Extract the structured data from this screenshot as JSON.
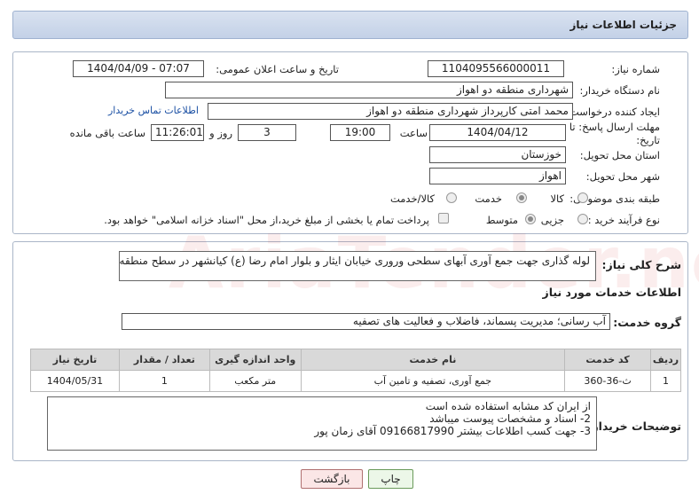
{
  "header": {
    "title": "جزئیات اطلاعات نیاز"
  },
  "watermark": "AriaTender.neT",
  "form": {
    "need_number_label": "شماره نیاز:",
    "need_number": "1104095566000011",
    "announce_label": "تاریخ و ساعت اعلان عمومی:",
    "announce_value": "1404/04/09 - 07:07",
    "buyer_org_label": "نام دستگاه خریدار:",
    "buyer_org": "شهرداری منطقه دو اهواز",
    "creator_label": "ایجاد کننده درخواست:",
    "creator": "محمد امتی کارپرداز شهرداری منطقه دو اهواز",
    "contact_link": "اطلاعات تماس خریدار",
    "deadline_label": "مهلت ارسال پاسخ: تا تاریخ:",
    "deadline_date": "1404/04/12",
    "time_label": "ساعت",
    "deadline_time": "19:00",
    "days_value": "3",
    "days_label": "روز و",
    "remaining_time": "11:26:01",
    "remaining_label": "ساعت باقی مانده",
    "province_label": "استان محل تحویل:",
    "province": "خوزستان",
    "city_label": "شهر محل تحویل:",
    "city": "اهواز",
    "category_label": "طبقه بندی موضوعی:",
    "category_options": [
      "کالا",
      "خدمت",
      "کالا/خدمت"
    ],
    "category_selected": "خدمت",
    "process_label": "نوع فرآیند خرید :",
    "process_options": [
      "جزیی",
      "متوسط"
    ],
    "process_selected": "متوسط",
    "payment_note": "پرداخت تمام یا بخشی از مبلغ خرید،از محل \"اسناد خزانه اسلامی\" خواهد بود."
  },
  "description": {
    "label": "شرح کلی نیاز:",
    "text": "لوله گذاری جهت جمع آوری آبهای سطحی وروری خیابان ایثار و بلوار امام رضا (ع) کیانشهر در سطح منطقه دو"
  },
  "services": {
    "section_title": "اطلاعات خدمات مورد نیاز",
    "group_label": "گروه خدمت:",
    "group_value": "آب رسانی؛ مدیریت پسماند، فاضلاب و فعالیت های تصفیه",
    "columns": [
      "ردیف",
      "کد خدمت",
      "نام خدمت",
      "واحد اندازه گیری",
      "تعداد / مقدار",
      "تاریخ نیاز"
    ],
    "rows": [
      [
        "1",
        "ث-36-360",
        "جمع آوری، تصفیه و تامین آب",
        "متر مکعب",
        "1",
        "1404/05/31"
      ]
    ]
  },
  "buyer_notes": {
    "label": "توضیحات خریدار:",
    "lines": [
      "از ایران کد مشابه استفاده شده است",
      "2- اسناد و مشخصات پیوست میباشد",
      "3- جهت کسب اطلاعات بیشتر 09166817990 آقای زمان پور"
    ]
  },
  "buttons": {
    "print": "چاپ",
    "back": "بازگشت"
  }
}
